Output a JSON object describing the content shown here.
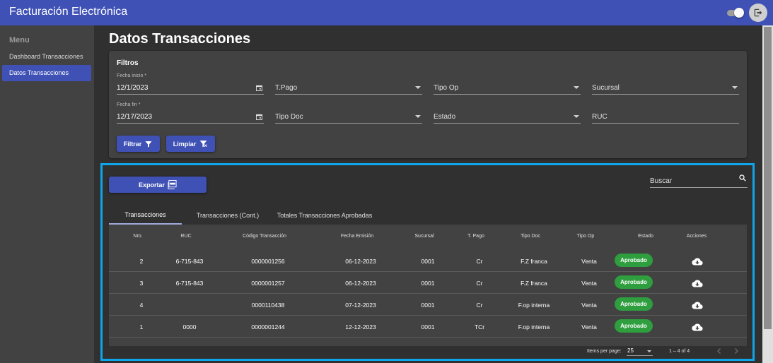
{
  "app": {
    "title": "Facturación Electrónica"
  },
  "sidebar": {
    "heading": "Menu",
    "items": [
      {
        "label": "Dashboard Transacciones"
      },
      {
        "label": "Datos Transacciones"
      }
    ]
  },
  "page": {
    "title": "Datos Transacciones"
  },
  "filters": {
    "heading": "Filtros",
    "fecha_inicio": {
      "label": "Fecha inicio *",
      "value": "12/1/2023"
    },
    "fecha_fin": {
      "label": "Fecha fin *",
      "value": "12/17/2023"
    },
    "tpago": {
      "placeholder": "T.Pago"
    },
    "tipo_op": {
      "placeholder": "Tipo Op"
    },
    "sucursal": {
      "placeholder": "Sucursal"
    },
    "tipo_doc": {
      "placeholder": "Tipo Doc"
    },
    "estado": {
      "placeholder": "Estado"
    },
    "ruc": {
      "placeholder": "RUC"
    },
    "filtrar_label": "Filtrar",
    "limpiar_label": "Limpiar"
  },
  "results": {
    "export_label": "Exportar",
    "search_placeholder": "Buscar",
    "tabs": [
      {
        "label": "Transacciones"
      },
      {
        "label": "Transacciones (Cont.)"
      },
      {
        "label": "Totales Transacciones Aprobadas"
      }
    ],
    "columns": [
      "Nro.",
      "RUC",
      "Código Transacción",
      "Fecha Emisión",
      "Sucursal",
      "T. Pago",
      "Tipo Doc",
      "Tipo Op",
      "Estado",
      "Acciones"
    ],
    "rows": [
      {
        "nro": "2",
        "ruc": "6-715-843",
        "codigo": "0000001256",
        "fecha": "06-12-2023",
        "sucursal": "0001",
        "tpago": "Cr",
        "tipo_doc": "F.Z franca",
        "tipo_op": "Venta",
        "estado": "Aprobado"
      },
      {
        "nro": "3",
        "ruc": "6-715-843",
        "codigo": "0000001257",
        "fecha": "06-12-2023",
        "sucursal": "0001",
        "tpago": "Cr",
        "tipo_doc": "F.Z franca",
        "tipo_op": "Venta",
        "estado": "Aprobado"
      },
      {
        "nro": "4",
        "ruc": "",
        "codigo": "0000110438",
        "fecha": "07-12-2023",
        "sucursal": "0001",
        "tpago": "Cr",
        "tipo_doc": "F.op interna",
        "tipo_op": "Venta",
        "estado": "Aprobado"
      },
      {
        "nro": "1",
        "ruc": "0000",
        "codigo": "0000001244",
        "fecha": "12-12-2023",
        "sucursal": "0001",
        "tpago": "TCr",
        "tipo_doc": "F.op interna",
        "tipo_op": "Venta",
        "estado": "Aprobado"
      }
    ],
    "paginator": {
      "items_per_page_label": "Items per page:",
      "page_size": "25",
      "range": "1 – 4 of 4"
    }
  },
  "colors": {
    "primary": "#3f51b5",
    "success": "#2e9e3e",
    "highlight": "#0ea5e9",
    "background": "#303030",
    "surface": "#424242"
  }
}
